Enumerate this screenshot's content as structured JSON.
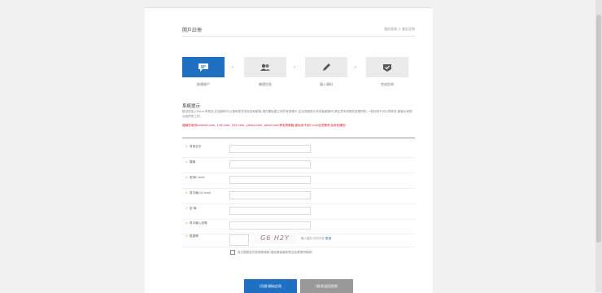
{
  "header": {
    "title": "開戶註冊",
    "breadcrumb": "我的首頁 > 會計註冊"
  },
  "steps": [
    {
      "label": "創建賬戶",
      "icon": "chat-icon"
    },
    {
      "label": "驗證信息",
      "icon": "users-icon"
    },
    {
      "label": "填入資料",
      "icon": "pencil-icon"
    },
    {
      "label": "完成註冊",
      "icon": "shield-check-icon"
    }
  ],
  "notice": {
    "title": "系統提示",
    "text": "歡迎您加入Pacer會員站,在這裡你可以發佈更多的信息和動態,現在開始建立你的會員帳戶,並且按照提示完成後續操作,請注意所填寫的真實資料,一經註冊不可以再修改,謝謝大家配合我們的工作。",
    "warning": "建議您使用hotmail.com, 126.com, 163.com, yahoo.com, gmail.com等免費郵箱,避免收不到E-mail註冊郵件及其他通知!"
  },
  "form": {
    "fields": [
      {
        "label": "會員名字"
      },
      {
        "label": "暱稱"
      },
      {
        "label": "常用E-mail"
      },
      {
        "label": "再次輸入E-mail"
      },
      {
        "label": "密 碼"
      },
      {
        "label": "再次輸入密碼"
      }
    ],
    "captcha": {
      "label": "驗證碼",
      "image_text": "G6 H2Y",
      "hint": "輸入圖片中的字母",
      "refresh": "更換"
    },
    "agree_text": "我已閱讀並同意服務條款,隱私權保護政策及免責聲明條款!"
  },
  "buttons": {
    "submit": "(同意)開始註冊",
    "back": "(取消)返回首頁"
  }
}
